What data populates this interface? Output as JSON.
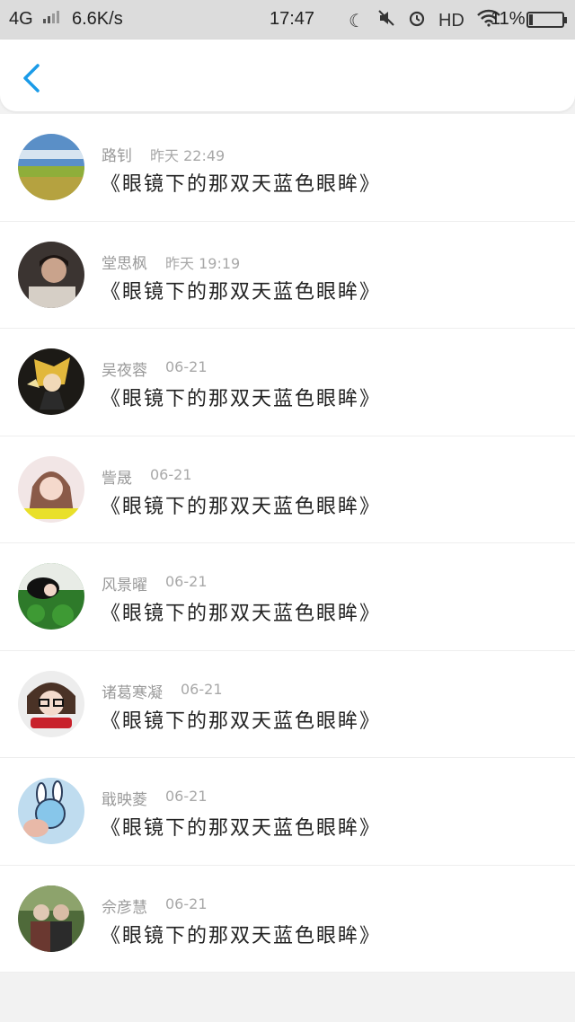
{
  "status_bar": {
    "network": "4G",
    "speed": "6.6K/s",
    "time": "17:47",
    "hd": "HD",
    "battery_pct": "11%",
    "battery_level": 0.11
  },
  "colors": {
    "accent": "#1a9be8",
    "status_bg": "#dcdcdc",
    "meta_text": "#9a9a9a"
  },
  "messages": [
    {
      "name": "路钊",
      "time": "昨天 22:49",
      "text": "《眼镜下的那双天蓝色眼眸》",
      "avatar": "landscape"
    },
    {
      "name": "堂思枫",
      "time": "昨天 19:19",
      "text": "《眼镜下的那双天蓝色眼眸》",
      "avatar": "person-dark"
    },
    {
      "name": "吴夜蓉",
      "time": "06-21",
      "text": "《眼镜下的那双天蓝色眼眸》",
      "avatar": "anime-gold"
    },
    {
      "name": "訾晟",
      "time": "06-21",
      "text": "《眼镜下的那双天蓝色眼眸》",
      "avatar": "girl-portrait"
    },
    {
      "name": "风景曜",
      "time": "06-21",
      "text": "《眼镜下的那双天蓝色眼眸》",
      "avatar": "grass-girl"
    },
    {
      "name": "诸葛寒凝",
      "time": "06-21",
      "text": "《眼镜下的那双天蓝色眼眸》",
      "avatar": "glasses-girl"
    },
    {
      "name": "戢映菱",
      "time": "06-21",
      "text": "《眼镜下的那双天蓝色眼眸》",
      "avatar": "bunny"
    },
    {
      "name": "佘彦慧",
      "time": "06-21",
      "text": "《眼镜下的那双天蓝色眼眸》",
      "avatar": "elderly-couple"
    }
  ]
}
